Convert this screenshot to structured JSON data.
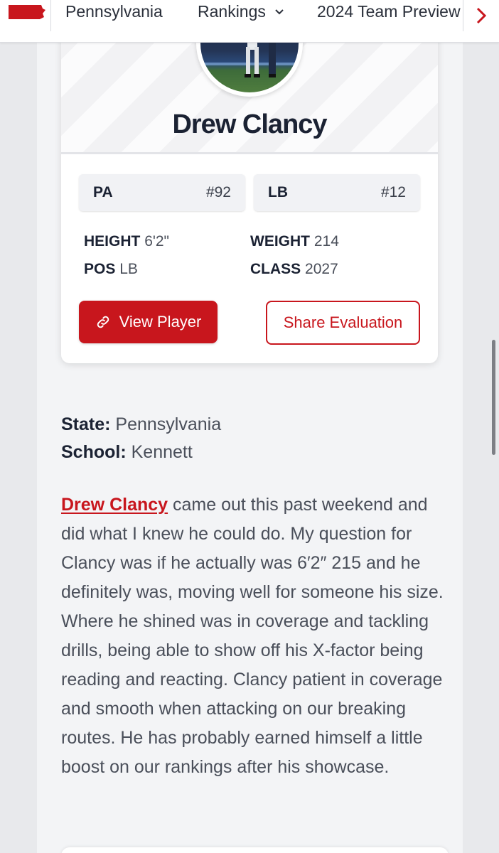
{
  "nav": {
    "items": [
      "Pennsylvania",
      "Rankings",
      "2024 Team Preview"
    ],
    "brand_color": "#c8161d"
  },
  "player": {
    "name": "Drew Clancy",
    "state_rank": {
      "label": "PA",
      "value": "#92"
    },
    "position_rank": {
      "label": "LB",
      "value": "#12"
    },
    "height": {
      "label": "HEIGHT",
      "value": "6'2\""
    },
    "weight": {
      "label": "WEIGHT",
      "value": "214"
    },
    "pos": {
      "label": "POS",
      "value": "LB"
    },
    "class": {
      "label": "CLASS",
      "value": "2027"
    },
    "view_button": "View Player",
    "share_button": "Share Evaluation"
  },
  "meta": {
    "state_label": "State:",
    "state_value": "Pennsylvania",
    "school_label": "School:",
    "school_value": "Kennett"
  },
  "article": {
    "player_link": "Drew Clancy",
    "body": " came out this past weekend and did what I knew he could do. My question for Clancy was if he actually was 6′2″ 215 and he definitely was, moving well for someone his size. Where he shined was in coverage and tackling drills, being able to show off his X-factor being reading and reacting. Clancy patient in coverage and smooth when attacking on our breaking routes. He has probably earned himself a little boost on our rankings after his showcase."
  },
  "icons": {
    "state_logo": "pennsylvania-state-icon",
    "rankings_chevron": "chevron-down-icon",
    "nav_scroll": "chevron-right-icon",
    "view_player": "link-icon"
  }
}
